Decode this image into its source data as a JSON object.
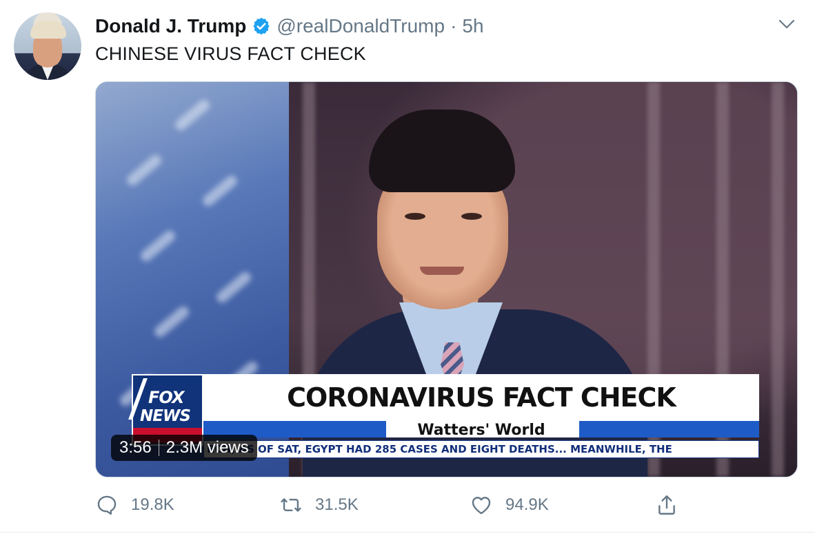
{
  "tweet": {
    "author_name": "Donald J. Trump",
    "handle": "@realDonaldTrump",
    "separator": "·",
    "time": "5h",
    "text": "CHINESE VIRUS FACT CHECK",
    "verified_color": "#1da1f2"
  },
  "video": {
    "duration": "3:56",
    "views": "2.3M views",
    "logo_top": "FOX",
    "logo_bottom": "NEWS",
    "headline": "CORONAVIRUS FACT CHECK",
    "subheadline": "Watters' World",
    "ticker": "RCH; AS OF SAT, EGYPT HAD 285 CASES AND EIGHT DEATHS...   MEANWHILE, THE"
  },
  "actions": {
    "replies": "19.8K",
    "retweets": "31.5K",
    "likes": "94.9K",
    "icons": [
      "reply-icon",
      "retweet-icon",
      "like-icon",
      "share-icon"
    ]
  },
  "colors": {
    "text_primary": "#14171a",
    "text_secondary": "#657786",
    "fox_blue": "#10337a"
  }
}
